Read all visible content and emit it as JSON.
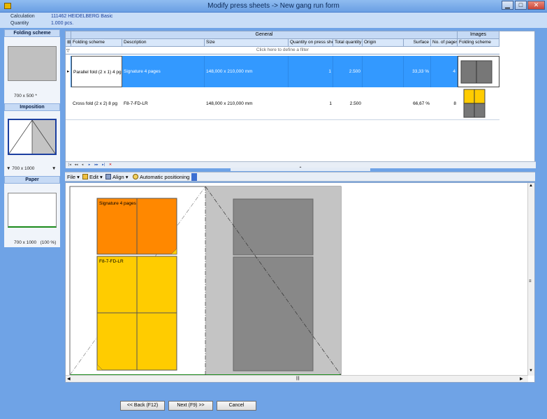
{
  "window": {
    "title": "Modify press sheets -> New gang run form",
    "minimize": "▁",
    "maximize": "□",
    "close": "✕"
  },
  "info": {
    "calculation_label": "Calculation",
    "calculation_value": "111462 HEIDELBERG Basic",
    "quantity_label": "Quantity",
    "quantity_value": "1.000 pcs."
  },
  "left_panel": {
    "folding_scheme_header": "Folding scheme",
    "folding_scheme_size": "700 x 500 *",
    "imposition_header": "Imposition",
    "imposition_size": "700 x 1000",
    "paper_header": "Paper",
    "paper_size": "700 x 1000",
    "paper_percent": "(100 %)"
  },
  "grid": {
    "group_general": "General",
    "group_images": "Images",
    "columns": [
      "Folding scheme",
      "Description",
      "Size",
      "Quantity on press she",
      "Total quantity",
      "Origin",
      "Surface",
      "No. of pages",
      "Folding scheme"
    ],
    "filter_placeholder": "Click here to define a filter",
    "rows": [
      {
        "folding_scheme": "Parallel fold (2 x 1) 4 pg",
        "description": "Signature 4 pages",
        "size": "148,000 x  210,000 mm",
        "qty_on_sheet": "1",
        "total_qty": "2.500",
        "origin": "",
        "surface": "33,33 %",
        "pages": "4"
      },
      {
        "folding_scheme": "Cross fold (2 x 2)  8 pg",
        "description": "F8-7-FD-LR",
        "size": "148,000 x  210,000 mm",
        "qty_on_sheet": "1",
        "total_qty": "2.500",
        "origin": "",
        "surface": "66,67 %",
        "pages": "8"
      }
    ]
  },
  "toolbar": {
    "file": "File",
    "edit": "Edit",
    "align": "Align",
    "auto_position": "Automatic positioning"
  },
  "canvas": {
    "label_sig4": "Signature 4 pages",
    "label_f8": "F8-7-FD-LR"
  },
  "buttons": {
    "back": "<< Back (F12)",
    "next": "Next (F9) >>",
    "cancel": "Cancel"
  },
  "colors": {
    "selection": "#3399ff",
    "orange": "#ff8800",
    "yellow": "#ffcc00",
    "plate_gray": "#888888",
    "sheet_gray": "#c4c4c4"
  }
}
